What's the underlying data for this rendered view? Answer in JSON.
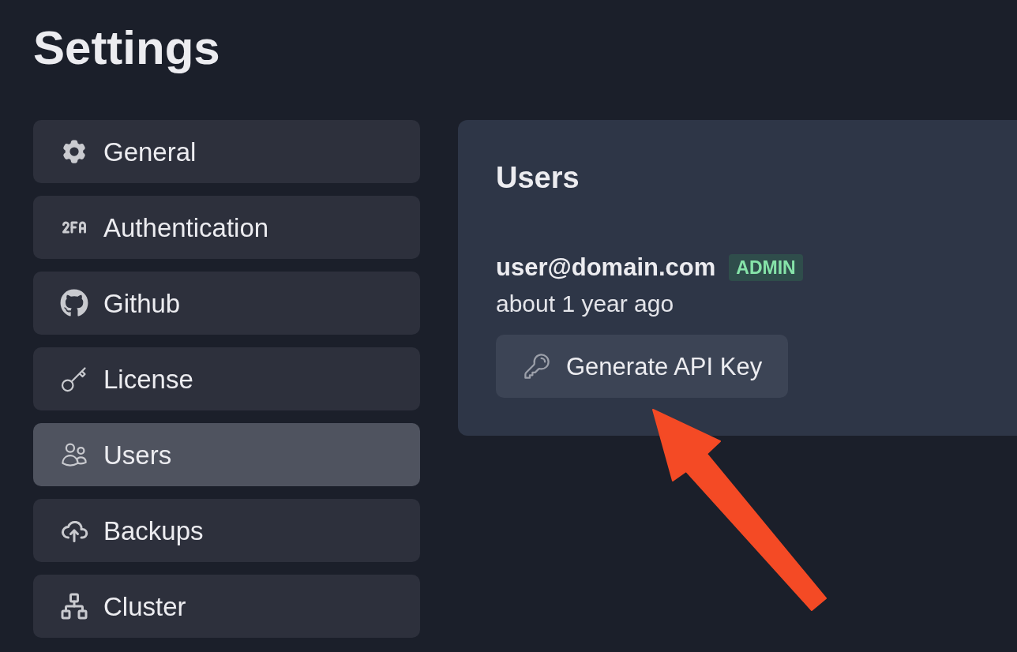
{
  "page": {
    "title": "Settings"
  },
  "sidebar": {
    "items": [
      {
        "label": "General",
        "selected": false
      },
      {
        "label": "Authentication",
        "selected": false
      },
      {
        "label": "Github",
        "selected": false
      },
      {
        "label": "License",
        "selected": false
      },
      {
        "label": "Users",
        "selected": true
      },
      {
        "label": "Backups",
        "selected": false
      },
      {
        "label": "Cluster",
        "selected": false
      }
    ]
  },
  "panel": {
    "title": "Users",
    "users": [
      {
        "email": "user@domain.com",
        "badge": "ADMIN",
        "joined": "about 1 year ago",
        "action": "Generate API Key"
      }
    ]
  }
}
